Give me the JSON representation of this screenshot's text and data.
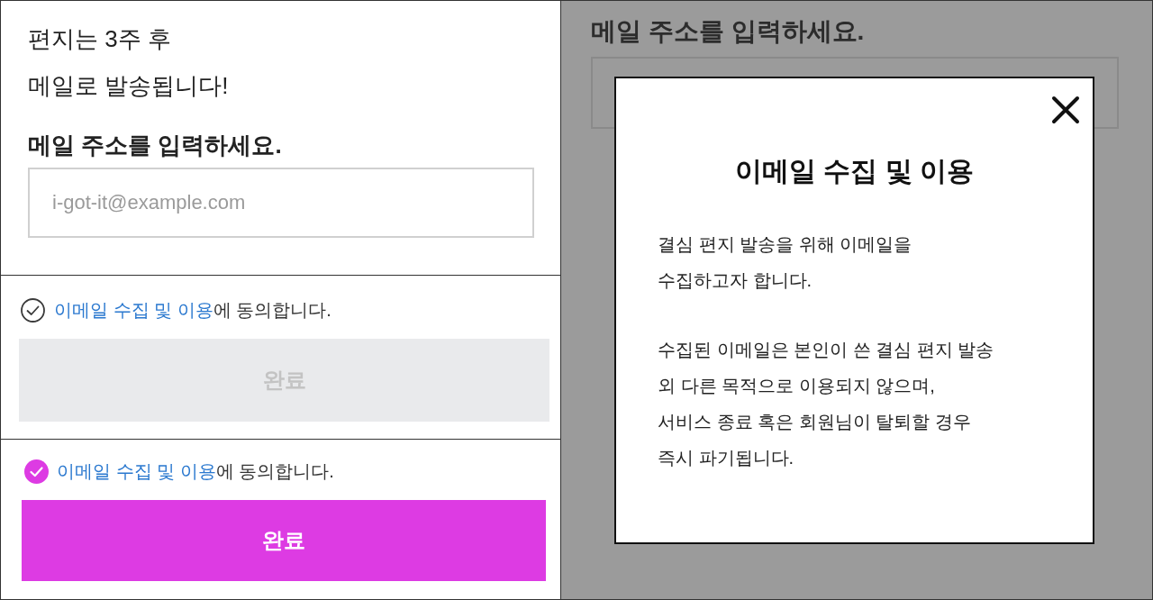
{
  "form": {
    "intro_lines": [
      "편지는 3주 후",
      "메일로 발송됩니다!"
    ],
    "email_label": "메일 주소를 입력하세요.",
    "email_field": {
      "placeholder": "i-got-it@example.com"
    }
  },
  "consents": [
    {
      "checked": false,
      "link": "이메일 수집 및 이용",
      "suffix": "에 동의합니다.",
      "button": {
        "label": "완료",
        "disabled": true
      }
    },
    {
      "checked": true,
      "link": "이메일 수집 및 이용",
      "suffix": "에 동의합니다.",
      "button": {
        "label": "완료",
        "disabled": false
      }
    }
  ],
  "background_page": {
    "email_label": "메일 주소를 입력하세요."
  },
  "modal": {
    "title": "이메일 수집 및 이용",
    "paragraphs": [
      [
        "결심 편지 발송을 위해 이메일을",
        "수집하고자 합니다."
      ],
      [
        "수집된 이메일은 본인이 쓴 결심 편지 발송",
        "외 다른 목적으로 이용되지 않으며,",
        "서비스 종료 혹은 회원님이 탈퇴할 경우",
        "즉시 파기됩니다."
      ]
    ]
  }
}
